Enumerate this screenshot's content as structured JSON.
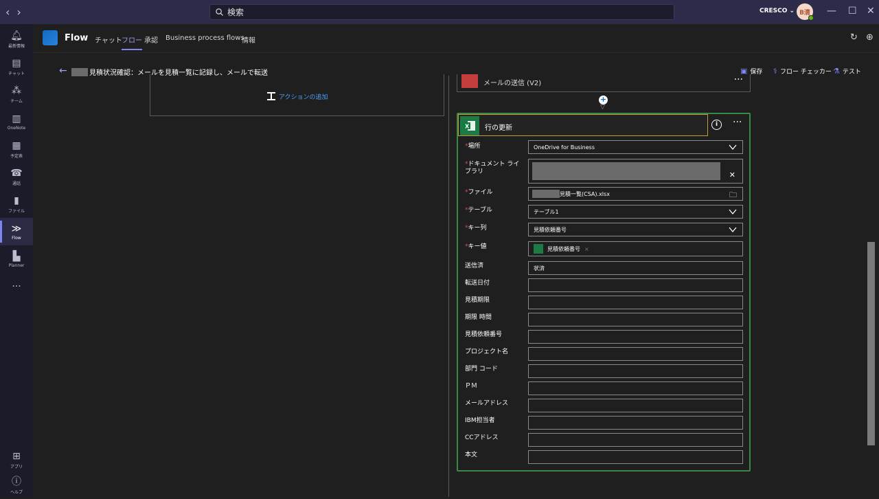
{
  "titlebar": {
    "search_placeholder": "検索",
    "tenant": "CRESCO ⌄",
    "avatar_initials": "B清"
  },
  "rail": {
    "items": [
      {
        "label": "最新情報",
        "icon": "bell-icon"
      },
      {
        "label": "チャット",
        "icon": "chat-icon"
      },
      {
        "label": "チーム",
        "icon": "teams-icon"
      },
      {
        "label": "OneNote",
        "icon": "onenote-icon"
      },
      {
        "label": "予定表",
        "icon": "calendar-icon"
      },
      {
        "label": "通話",
        "icon": "phone-icon"
      },
      {
        "label": "ファイル",
        "icon": "file-icon"
      },
      {
        "label": "Flow",
        "icon": "flow-icon"
      },
      {
        "label": "Planner",
        "icon": "planner-icon"
      }
    ],
    "apps_label": "アプリ",
    "help_label": "ヘルプ"
  },
  "appbar": {
    "title": "Flow",
    "tabs": [
      "チャット",
      "フロー",
      "承認",
      "Business process flows",
      "情報"
    ],
    "active_tab": "フロー"
  },
  "flow": {
    "title": "見積状況確認：メールを見積一覧に記録し、メールで転送",
    "commands": {
      "save": "保存",
      "checker": "フロー チェッカー",
      "test": "テスト"
    },
    "add_action": "アクションの追加",
    "prev_card_title": "メールの送信 (V2)"
  },
  "card": {
    "title": "行の更新",
    "fields": [
      {
        "label": "場所",
        "required": true,
        "value": "OneDrive for Business",
        "type": "dropdown"
      },
      {
        "label": "ドキュメント ライブラリ",
        "required": true,
        "value": "",
        "type": "redacted-clear"
      },
      {
        "label": "ファイル",
        "required": true,
        "value": "見積一覧(CSA).xlsx",
        "type": "file"
      },
      {
        "label": "テーブル",
        "required": true,
        "value": "テーブル1",
        "type": "dropdown"
      },
      {
        "label": "キー列",
        "required": true,
        "value": "見積依頼番号",
        "type": "dropdown"
      },
      {
        "label": "キー値",
        "required": true,
        "value": "見積依頼番号",
        "type": "token"
      },
      {
        "label": "送信済",
        "required": false,
        "value": "状済",
        "type": "text"
      },
      {
        "label": "転送日付",
        "required": false,
        "value": "",
        "type": "text"
      },
      {
        "label": "見積期限",
        "required": false,
        "value": "",
        "type": "text"
      },
      {
        "label": "期限 時間",
        "required": false,
        "value": "",
        "type": "text"
      },
      {
        "label": "見積依頼番号",
        "required": false,
        "value": "",
        "type": "text"
      },
      {
        "label": "プロジェクト名",
        "required": false,
        "value": "",
        "type": "text"
      },
      {
        "label": "部門 コード",
        "required": false,
        "value": "",
        "type": "text"
      },
      {
        "label": "ＰＭ",
        "required": false,
        "value": "",
        "type": "text"
      },
      {
        "label": "メールアドレス",
        "required": false,
        "value": "",
        "type": "text"
      },
      {
        "label": "IBM担当者",
        "required": false,
        "value": "",
        "type": "text"
      },
      {
        "label": "CCアドレス",
        "required": false,
        "value": "",
        "type": "text"
      },
      {
        "label": "本文",
        "required": false,
        "value": "",
        "type": "text"
      }
    ]
  },
  "colors": {
    "accent": "#7f85f5",
    "excel": "#1d7a45",
    "card_border": "#3a8a46",
    "header_border": "#c19c3a"
  }
}
